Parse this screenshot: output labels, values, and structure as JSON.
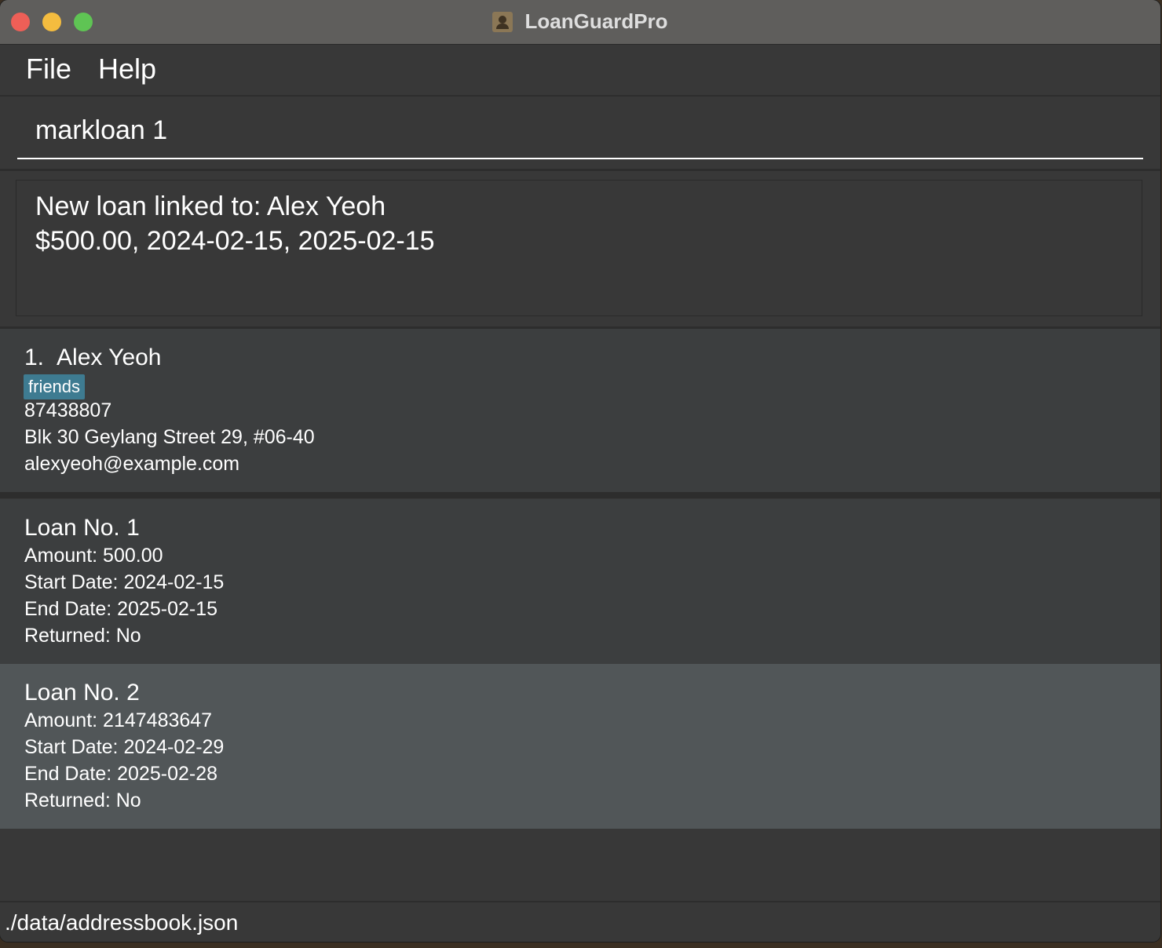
{
  "window": {
    "title": "LoanGuardPro",
    "app_icon": "contact-card-icon"
  },
  "menubar": {
    "items": [
      {
        "label": "File"
      },
      {
        "label": "Help"
      }
    ]
  },
  "command_box": {
    "value": "markloan 1"
  },
  "result_display": {
    "lines": [
      "New loan linked to: Alex Yeoh",
      "$500.00, 2024-02-15, 2025-02-15"
    ]
  },
  "person": {
    "index": "1.",
    "name": "Alex Yeoh",
    "tags": [
      "friends"
    ],
    "phone": "87438807",
    "address": "Blk 30 Geylang Street 29, #06-40",
    "email": "alexyeoh@example.com"
  },
  "loans": [
    {
      "title": "Loan No. 1",
      "amount": "Amount: 500.00",
      "start_date": "Start Date: 2024-02-15",
      "end_date": "End Date: 2025-02-15",
      "returned": "Returned: No",
      "selected": false
    },
    {
      "title": "Loan No. 2",
      "amount": "Amount: 2147483647",
      "start_date": "Start Date: 2024-02-29",
      "end_date": "End Date: 2025-02-28",
      "returned": "Returned: No",
      "selected": true
    }
  ],
  "statusbar": {
    "path": "./data/addressbook.json"
  },
  "colors": {
    "tag_background": "#3e7b91",
    "selected_card": "#515658",
    "card": "#3c3e3f",
    "background": "#383838"
  }
}
